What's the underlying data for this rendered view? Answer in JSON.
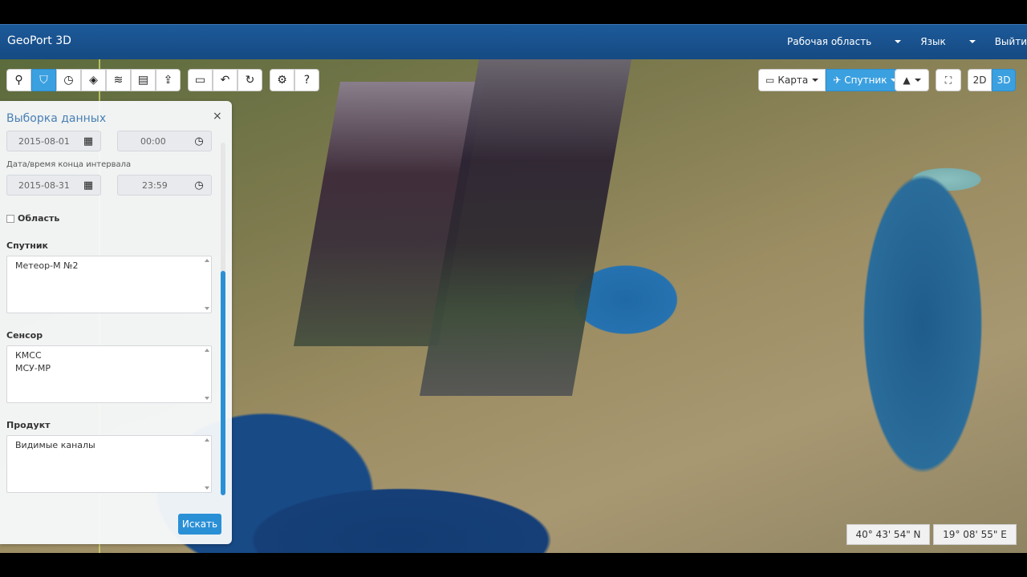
{
  "app": {
    "title": "GeoPort 3D"
  },
  "nav": {
    "workspace": "Рабочая область",
    "language": "Язык",
    "logout": "Выйти"
  },
  "toolbar": {
    "group1": [
      "map-pin-icon",
      "filter-icon",
      "timer-icon",
      "layers-paint-icon",
      "stack-icon",
      "list-icon",
      "upload-icon"
    ],
    "group2": [
      "select-rect-icon",
      "undo-icon",
      "redo-icon"
    ],
    "group3": [
      "gear-icon",
      "help-icon"
    ],
    "glyphs1": [
      "⚲",
      "⛉",
      "◷",
      "◈",
      "≋",
      "▤",
      "⇪"
    ],
    "glyphs2": [
      "▭",
      "↶",
      "↻"
    ],
    "glyphs3": [
      "⚙",
      "?"
    ]
  },
  "viewcontrols": {
    "map": "Карта",
    "satellite": "Спутник",
    "mode2d": "2D",
    "mode3d": "3D"
  },
  "panel": {
    "title": "Выборка данных",
    "close": "×",
    "start_date": "2015-08-01",
    "start_time": "00:00",
    "end_label": "Дата/время конца интервала",
    "end_date": "2015-08-31",
    "end_time": "23:59",
    "area_label": "Область",
    "satellite_label": "Спутник",
    "satellite_values": [
      "Метеор-М №2"
    ],
    "sensor_label": "Сенсор",
    "sensor_values": [
      "КМСС",
      "МСУ-МР"
    ],
    "product_label": "Продукт",
    "product_values": [
      "Видимые каналы"
    ],
    "search_button": "Искать"
  },
  "coords": {
    "lat": "40° 43' 54\"  N",
    "lon": "19° 08' 55\"  E"
  }
}
